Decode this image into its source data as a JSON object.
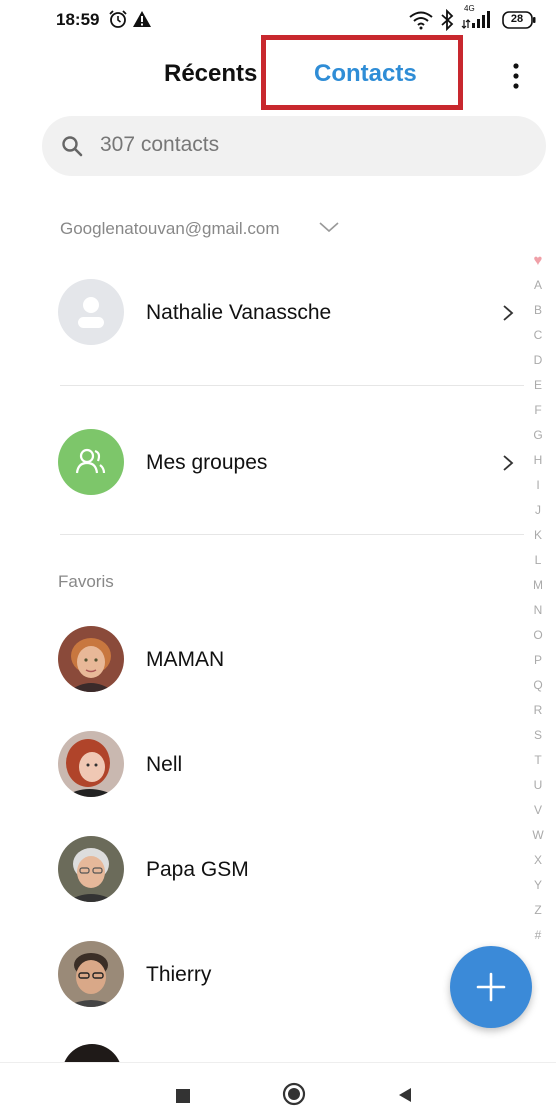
{
  "status_bar": {
    "time": "18:59",
    "network_type": "4G",
    "battery": "28",
    "icons": [
      "alarm-icon",
      "warning-icon",
      "wifi-icon",
      "bluetooth-icon",
      "signal-icon",
      "battery-icon"
    ]
  },
  "header": {
    "tabs": [
      {
        "label": "Récents",
        "active": false
      },
      {
        "label": "Contacts",
        "active": true
      }
    ],
    "accent_color": "#2f8dd6",
    "highlight_color": "#c8282e"
  },
  "search": {
    "placeholder": "307 contacts"
  },
  "account": {
    "email": "Googlenatouvan@gmail.com"
  },
  "profile": {
    "name": "Nathalie Vanassche"
  },
  "groups": {
    "label": "Mes groupes"
  },
  "favorites": {
    "header": "Favoris",
    "items": [
      {
        "name": "MAMAN"
      },
      {
        "name": "Nell"
      },
      {
        "name": "Papa GSM"
      },
      {
        "name": "Thierry"
      }
    ]
  },
  "alpha_index": [
    "♥",
    "A",
    "B",
    "C",
    "D",
    "E",
    "F",
    "G",
    "H",
    "I",
    "J",
    "K",
    "L",
    "M",
    "N",
    "O",
    "P",
    "Q",
    "R",
    "S",
    "T",
    "U",
    "V",
    "W",
    "X",
    "Y",
    "Z",
    "#"
  ],
  "fab": {
    "icon": "plus-icon",
    "color": "#3b8ad8"
  }
}
